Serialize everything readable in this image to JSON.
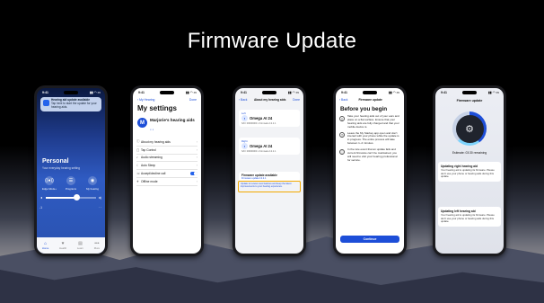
{
  "slide": {
    "title": "Firmware Update"
  },
  "status_time": "9:41",
  "status_icons": "▮▮ ◠ ▭",
  "phone1": {
    "notification": {
      "title": "Hearing aid update available",
      "body": "Tap here to start the update for your hearing aids."
    },
    "program_name": "Personal",
    "program_sub": "Your everyday hearing setting",
    "buttons": [
      {
        "icon": "((●))",
        "label": "Edge Mode+"
      },
      {
        "icon": "☰",
        "label": "Programs"
      },
      {
        "icon": "◉",
        "label": "My hearing"
      }
    ],
    "vol_low": "◂",
    "vol_high": "◂)",
    "volume_value": "-1",
    "pager": "· ·",
    "tabs": [
      {
        "icon": "⌂",
        "label": "Home"
      },
      {
        "icon": "♥",
        "label": "Health"
      },
      {
        "icon": "▤",
        "label": "Learn"
      },
      {
        "icon": "•••",
        "label": "More"
      }
    ]
  },
  "phone2": {
    "nav_back": "‹ My Hearing",
    "nav_done": "Done",
    "title": "My settings",
    "avatar_initial": "M",
    "profile_name": "Marjorie's hearing aids",
    "profile_devices": "◖ ◗",
    "menu": [
      {
        "icon": "ⓘ",
        "label": "About my hearing aids"
      },
      {
        "icon": "▢",
        "label": "Tap Control"
      },
      {
        "icon": "♪",
        "label": "Audio streaming"
      },
      {
        "icon": "☾",
        "label": "Auto Sleep"
      },
      {
        "icon": "☏",
        "label": "Accept/decline call"
      },
      {
        "icon": "✈",
        "label": "Offline mode"
      }
    ]
  },
  "phone3": {
    "nav_back": "‹ Back",
    "nav_title": "About my hearing aids",
    "nav_done": "Done",
    "devices": [
      {
        "side": "Left",
        "name": "Omega AI 24",
        "info": "S/N: 00000000 • Firmware 13.2.1"
      },
      {
        "side": "Right",
        "name": "Omega AI 24",
        "info": "S/N: 00000000 • Firmware 13.2.1"
      }
    ],
    "firmware_title": "Firmware update available",
    "firmware_sub": "Firmware update 13.2.1",
    "highlight_text": "Update to receive new features and keep the latest improvements to your hearing experience."
  },
  "phone4": {
    "nav_back": "‹ Back",
    "nav_title": "Firmware update",
    "title": "Before you begin",
    "steps": [
      {
        "icon": "◻",
        "text": "Take your hearing aids out of your ears and place on a flat surface. Ensure that your hearing aids are fully charged and that your mobile device is."
      },
      {
        "icon": "◷",
        "text": "Leave the My Starkey app open and don't interact with your phone while the update is in progress. The entire process will take between 1–2 minutes."
      },
      {
        "icon": "ⓘ",
        "text": "In the rare event that an update fails and current firmware can't be maintained, you will need to visit your hearing professional for service."
      }
    ],
    "cta": "Continue"
  },
  "phone5": {
    "title": "Firmware update",
    "center_icon": "⚙",
    "estimate": "Estimate: 03:30 remaining",
    "cards": [
      {
        "title": "Updating right hearing aid",
        "body": "Your hearing aid is updating its firmware. Please don't use your phone or hearing aids during this update."
      },
      {
        "title": "Updating left hearing aid",
        "body": "Your hearing aid is updating its firmware. Please don't use your phone or hearing aids during this update."
      }
    ]
  }
}
